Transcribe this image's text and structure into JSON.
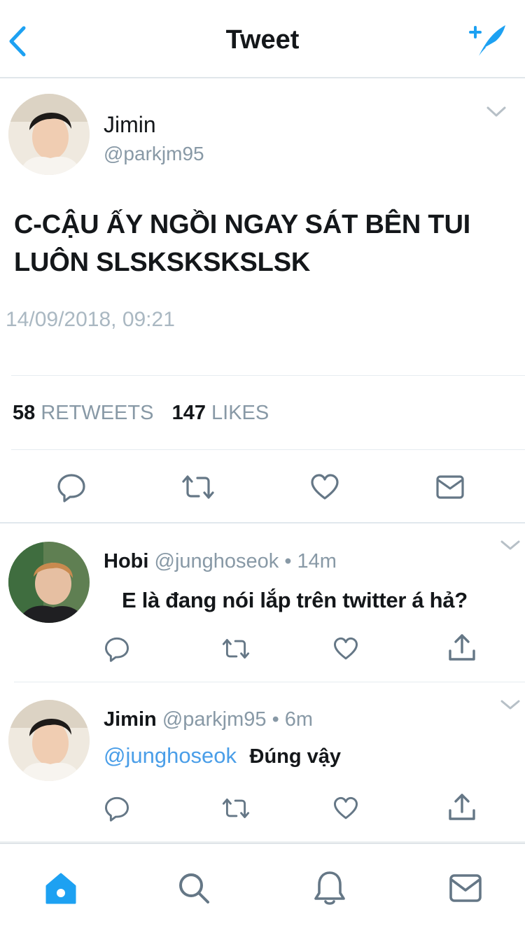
{
  "header": {
    "title": "Tweet"
  },
  "main_tweet": {
    "name": "Jimin",
    "handle": "@parkjm95",
    "text_line1": "C-CẬU ẤY NGỒI NGAY SÁT BÊN TUI",
    "text_line2": "LUÔN SLSKSKSKSLSK",
    "timestamp": "14/09/2018, 09:21",
    "retweet_count": "58",
    "retweet_label": "RETWEETS",
    "like_count": "147",
    "like_label": "LIKES"
  },
  "replies": [
    {
      "name": "Hobi",
      "handle": "@junghoseok",
      "time": "• 14m",
      "text": "E là đang nói lắp trên twitter á hả?"
    },
    {
      "name": "Jimin",
      "handle": "@parkjm95",
      "time": "• 6m",
      "mention": "@junghoseok",
      "text": "Đúng vậy"
    }
  ],
  "colors": {
    "accent": "#1da1f2",
    "muted": "#8899a6",
    "icon": "#657786"
  },
  "icons": [
    "back-arrow-icon",
    "compose-tweet-icon",
    "chevron-down-icon",
    "reply-icon",
    "retweet-icon",
    "like-icon",
    "share-icon",
    "message-icon",
    "home-icon",
    "search-icon",
    "notifications-icon"
  ]
}
